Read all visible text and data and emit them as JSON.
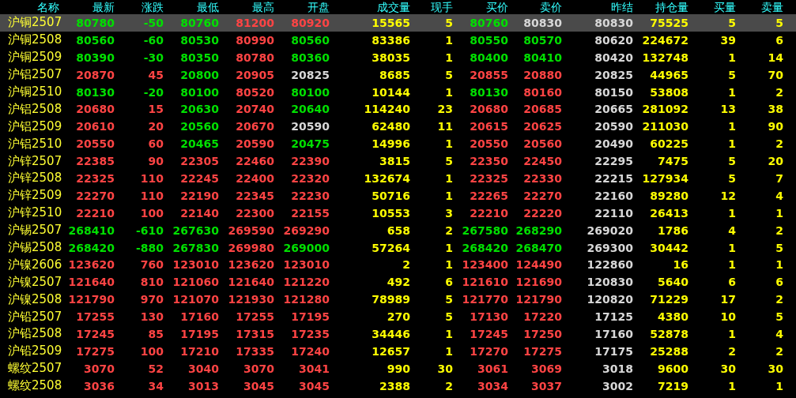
{
  "columns": [
    {
      "label": "名称",
      "kind": "name"
    },
    {
      "label": "最新",
      "kind": "price"
    },
    {
      "label": "涨跌",
      "kind": "price"
    },
    {
      "label": "最低",
      "kind": "price"
    },
    {
      "label": "最高",
      "kind": "price"
    },
    {
      "label": "开盘",
      "kind": "price"
    },
    {
      "label": "成交量",
      "kind": "volume"
    },
    {
      "label": "现手",
      "kind": "volume"
    },
    {
      "label": "买价",
      "kind": "price"
    },
    {
      "label": "卖价",
      "kind": "price"
    },
    {
      "label": "昨结",
      "kind": "plain"
    },
    {
      "label": "持仓量",
      "kind": "volume"
    },
    {
      "label": "买量",
      "kind": "volume"
    },
    {
      "label": "卖量",
      "kind": "volume"
    }
  ],
  "rows": [
    {
      "selected": true,
      "cells": [
        {
          "text": "沪铜2507"
        },
        {
          "text": "80780",
          "color": "#00e000"
        },
        {
          "text": "-50",
          "color": "#00e000"
        },
        {
          "text": "80760",
          "color": "#00e000"
        },
        {
          "text": "81200",
          "color": "#ff4444"
        },
        {
          "text": "80920",
          "color": "#ff4444"
        },
        {
          "text": "15565"
        },
        {
          "text": "5"
        },
        {
          "text": "80760",
          "color": "#00e000"
        },
        {
          "text": "80830",
          "color": "#d8d8d8"
        },
        {
          "text": "80830"
        },
        {
          "text": "75525"
        },
        {
          "text": "5"
        },
        {
          "text": "5"
        }
      ]
    },
    {
      "selected": false,
      "cells": [
        {
          "text": "沪铜2508"
        },
        {
          "text": "80560",
          "color": "#00e000"
        },
        {
          "text": "-60",
          "color": "#00e000"
        },
        {
          "text": "80530",
          "color": "#00e000"
        },
        {
          "text": "80990",
          "color": "#ff4444"
        },
        {
          "text": "80560",
          "color": "#00e000"
        },
        {
          "text": "83386"
        },
        {
          "text": "1"
        },
        {
          "text": "80550",
          "color": "#00e000"
        },
        {
          "text": "80570",
          "color": "#00e000"
        },
        {
          "text": "80620"
        },
        {
          "text": "224672"
        },
        {
          "text": "39"
        },
        {
          "text": "6"
        }
      ]
    },
    {
      "selected": false,
      "cells": [
        {
          "text": "沪铜2509"
        },
        {
          "text": "80390",
          "color": "#00e000"
        },
        {
          "text": "-30",
          "color": "#00e000"
        },
        {
          "text": "80350",
          "color": "#00e000"
        },
        {
          "text": "80780",
          "color": "#ff4444"
        },
        {
          "text": "80360",
          "color": "#00e000"
        },
        {
          "text": "38035"
        },
        {
          "text": "1"
        },
        {
          "text": "80400",
          "color": "#00e000"
        },
        {
          "text": "80410",
          "color": "#00e000"
        },
        {
          "text": "80420"
        },
        {
          "text": "132748"
        },
        {
          "text": "1"
        },
        {
          "text": "14"
        }
      ]
    },
    {
      "selected": false,
      "cells": [
        {
          "text": "沪铝2507"
        },
        {
          "text": "20870",
          "color": "#ff4444"
        },
        {
          "text": "45",
          "color": "#ff4444"
        },
        {
          "text": "20800",
          "color": "#00e000"
        },
        {
          "text": "20905",
          "color": "#ff4444"
        },
        {
          "text": "20825",
          "color": "#d8d8d8"
        },
        {
          "text": "8685"
        },
        {
          "text": "5"
        },
        {
          "text": "20855",
          "color": "#ff4444"
        },
        {
          "text": "20880",
          "color": "#ff4444"
        },
        {
          "text": "20825"
        },
        {
          "text": "44965"
        },
        {
          "text": "5"
        },
        {
          "text": "70"
        }
      ]
    },
    {
      "selected": false,
      "cells": [
        {
          "text": "沪铜2510"
        },
        {
          "text": "80130",
          "color": "#00e000"
        },
        {
          "text": "-20",
          "color": "#00e000"
        },
        {
          "text": "80100",
          "color": "#00e000"
        },
        {
          "text": "80520",
          "color": "#ff4444"
        },
        {
          "text": "80100",
          "color": "#00e000"
        },
        {
          "text": "10144"
        },
        {
          "text": "1"
        },
        {
          "text": "80130",
          "color": "#00e000"
        },
        {
          "text": "80160",
          "color": "#ff4444"
        },
        {
          "text": "80150"
        },
        {
          "text": "53808"
        },
        {
          "text": "1"
        },
        {
          "text": "2"
        }
      ]
    },
    {
      "selected": false,
      "cells": [
        {
          "text": "沪铝2508"
        },
        {
          "text": "20680",
          "color": "#ff4444"
        },
        {
          "text": "15",
          "color": "#ff4444"
        },
        {
          "text": "20630",
          "color": "#00e000"
        },
        {
          "text": "20740",
          "color": "#ff4444"
        },
        {
          "text": "20640",
          "color": "#00e000"
        },
        {
          "text": "114240"
        },
        {
          "text": "23"
        },
        {
          "text": "20680",
          "color": "#ff4444"
        },
        {
          "text": "20685",
          "color": "#ff4444"
        },
        {
          "text": "20665"
        },
        {
          "text": "281092"
        },
        {
          "text": "13"
        },
        {
          "text": "38"
        }
      ]
    },
    {
      "selected": false,
      "cells": [
        {
          "text": "沪铝2509"
        },
        {
          "text": "20610",
          "color": "#ff4444"
        },
        {
          "text": "20",
          "color": "#ff4444"
        },
        {
          "text": "20560",
          "color": "#00e000"
        },
        {
          "text": "20670",
          "color": "#ff4444"
        },
        {
          "text": "20590",
          "color": "#d8d8d8"
        },
        {
          "text": "62480"
        },
        {
          "text": "11"
        },
        {
          "text": "20615",
          "color": "#ff4444"
        },
        {
          "text": "20625",
          "color": "#ff4444"
        },
        {
          "text": "20590"
        },
        {
          "text": "211030"
        },
        {
          "text": "1"
        },
        {
          "text": "90"
        }
      ]
    },
    {
      "selected": false,
      "cells": [
        {
          "text": "沪铝2510"
        },
        {
          "text": "20550",
          "color": "#ff4444"
        },
        {
          "text": "60",
          "color": "#ff4444"
        },
        {
          "text": "20465",
          "color": "#00e000"
        },
        {
          "text": "20590",
          "color": "#ff4444"
        },
        {
          "text": "20475",
          "color": "#00e000"
        },
        {
          "text": "14996"
        },
        {
          "text": "1"
        },
        {
          "text": "20550",
          "color": "#ff4444"
        },
        {
          "text": "20560",
          "color": "#ff4444"
        },
        {
          "text": "20490"
        },
        {
          "text": "60225"
        },
        {
          "text": "1"
        },
        {
          "text": "2"
        }
      ]
    },
    {
      "selected": false,
      "cells": [
        {
          "text": "沪锌2507"
        },
        {
          "text": "22385",
          "color": "#ff4444"
        },
        {
          "text": "90",
          "color": "#ff4444"
        },
        {
          "text": "22305",
          "color": "#ff4444"
        },
        {
          "text": "22460",
          "color": "#ff4444"
        },
        {
          "text": "22390",
          "color": "#ff4444"
        },
        {
          "text": "3815"
        },
        {
          "text": "5"
        },
        {
          "text": "22350",
          "color": "#ff4444"
        },
        {
          "text": "22450",
          "color": "#ff4444"
        },
        {
          "text": "22295"
        },
        {
          "text": "7475"
        },
        {
          "text": "5"
        },
        {
          "text": "20"
        }
      ]
    },
    {
      "selected": false,
      "cells": [
        {
          "text": "沪锌2508"
        },
        {
          "text": "22325",
          "color": "#ff4444"
        },
        {
          "text": "110",
          "color": "#ff4444"
        },
        {
          "text": "22245",
          "color": "#ff4444"
        },
        {
          "text": "22400",
          "color": "#ff4444"
        },
        {
          "text": "22320",
          "color": "#ff4444"
        },
        {
          "text": "132674"
        },
        {
          "text": "1"
        },
        {
          "text": "22325",
          "color": "#ff4444"
        },
        {
          "text": "22330",
          "color": "#ff4444"
        },
        {
          "text": "22215"
        },
        {
          "text": "127934"
        },
        {
          "text": "5"
        },
        {
          "text": "7"
        }
      ]
    },
    {
      "selected": false,
      "cells": [
        {
          "text": "沪锌2509"
        },
        {
          "text": "22270",
          "color": "#ff4444"
        },
        {
          "text": "110",
          "color": "#ff4444"
        },
        {
          "text": "22190",
          "color": "#ff4444"
        },
        {
          "text": "22345",
          "color": "#ff4444"
        },
        {
          "text": "22230",
          "color": "#ff4444"
        },
        {
          "text": "50716"
        },
        {
          "text": "1"
        },
        {
          "text": "22265",
          "color": "#ff4444"
        },
        {
          "text": "22270",
          "color": "#ff4444"
        },
        {
          "text": "22160"
        },
        {
          "text": "89280"
        },
        {
          "text": "12"
        },
        {
          "text": "4"
        }
      ]
    },
    {
      "selected": false,
      "cells": [
        {
          "text": "沪锌2510"
        },
        {
          "text": "22210",
          "color": "#ff4444"
        },
        {
          "text": "100",
          "color": "#ff4444"
        },
        {
          "text": "22140",
          "color": "#ff4444"
        },
        {
          "text": "22300",
          "color": "#ff4444"
        },
        {
          "text": "22155",
          "color": "#ff4444"
        },
        {
          "text": "10553"
        },
        {
          "text": "3"
        },
        {
          "text": "22210",
          "color": "#ff4444"
        },
        {
          "text": "22220",
          "color": "#ff4444"
        },
        {
          "text": "22110"
        },
        {
          "text": "26413"
        },
        {
          "text": "1"
        },
        {
          "text": "1"
        }
      ]
    },
    {
      "selected": false,
      "cells": [
        {
          "text": "沪锡2507"
        },
        {
          "text": "268410",
          "color": "#00e000"
        },
        {
          "text": "-610",
          "color": "#00e000"
        },
        {
          "text": "267630",
          "color": "#00e000"
        },
        {
          "text": "269590",
          "color": "#ff4444"
        },
        {
          "text": "269290",
          "color": "#ff4444"
        },
        {
          "text": "658"
        },
        {
          "text": "2"
        },
        {
          "text": "267580",
          "color": "#00e000"
        },
        {
          "text": "268290",
          "color": "#00e000"
        },
        {
          "text": "269020"
        },
        {
          "text": "1786"
        },
        {
          "text": "4"
        },
        {
          "text": "2"
        }
      ]
    },
    {
      "selected": false,
      "cells": [
        {
          "text": "沪锡2508"
        },
        {
          "text": "268420",
          "color": "#00e000"
        },
        {
          "text": "-880",
          "color": "#00e000"
        },
        {
          "text": "267830",
          "color": "#00e000"
        },
        {
          "text": "269980",
          "color": "#ff4444"
        },
        {
          "text": "269000",
          "color": "#00e000"
        },
        {
          "text": "57264"
        },
        {
          "text": "1"
        },
        {
          "text": "268420",
          "color": "#00e000"
        },
        {
          "text": "268470",
          "color": "#00e000"
        },
        {
          "text": "269300"
        },
        {
          "text": "30442"
        },
        {
          "text": "1"
        },
        {
          "text": "5"
        }
      ]
    },
    {
      "selected": false,
      "cells": [
        {
          "text": "沪镍2606"
        },
        {
          "text": "123620",
          "color": "#ff4444"
        },
        {
          "text": "760",
          "color": "#ff4444"
        },
        {
          "text": "123010",
          "color": "#ff4444"
        },
        {
          "text": "123620",
          "color": "#ff4444"
        },
        {
          "text": "123010",
          "color": "#ff4444"
        },
        {
          "text": "2"
        },
        {
          "text": "1"
        },
        {
          "text": "123400",
          "color": "#ff4444"
        },
        {
          "text": "124490",
          "color": "#ff4444"
        },
        {
          "text": "122860"
        },
        {
          "text": "16"
        },
        {
          "text": "1"
        },
        {
          "text": "1"
        }
      ]
    },
    {
      "selected": false,
      "cells": [
        {
          "text": "沪镍2507"
        },
        {
          "text": "121640",
          "color": "#ff4444"
        },
        {
          "text": "810",
          "color": "#ff4444"
        },
        {
          "text": "121060",
          "color": "#ff4444"
        },
        {
          "text": "121640",
          "color": "#ff4444"
        },
        {
          "text": "121220",
          "color": "#ff4444"
        },
        {
          "text": "492"
        },
        {
          "text": "6"
        },
        {
          "text": "121610",
          "color": "#ff4444"
        },
        {
          "text": "121690",
          "color": "#ff4444"
        },
        {
          "text": "120830"
        },
        {
          "text": "5640"
        },
        {
          "text": "6"
        },
        {
          "text": "6"
        }
      ]
    },
    {
      "selected": false,
      "cells": [
        {
          "text": "沪镍2508"
        },
        {
          "text": "121790",
          "color": "#ff4444"
        },
        {
          "text": "970",
          "color": "#ff4444"
        },
        {
          "text": "121070",
          "color": "#ff4444"
        },
        {
          "text": "121930",
          "color": "#ff4444"
        },
        {
          "text": "121280",
          "color": "#ff4444"
        },
        {
          "text": "78989"
        },
        {
          "text": "5"
        },
        {
          "text": "121770",
          "color": "#ff4444"
        },
        {
          "text": "121790",
          "color": "#ff4444"
        },
        {
          "text": "120820"
        },
        {
          "text": "71229"
        },
        {
          "text": "17"
        },
        {
          "text": "2"
        }
      ]
    },
    {
      "selected": false,
      "cells": [
        {
          "text": "沪铅2507"
        },
        {
          "text": "17255",
          "color": "#ff4444"
        },
        {
          "text": "130",
          "color": "#ff4444"
        },
        {
          "text": "17160",
          "color": "#ff4444"
        },
        {
          "text": "17255",
          "color": "#ff4444"
        },
        {
          "text": "17195",
          "color": "#ff4444"
        },
        {
          "text": "270"
        },
        {
          "text": "5"
        },
        {
          "text": "17130",
          "color": "#ff4444"
        },
        {
          "text": "17220",
          "color": "#ff4444"
        },
        {
          "text": "17125"
        },
        {
          "text": "4380"
        },
        {
          "text": "10"
        },
        {
          "text": "5"
        }
      ]
    },
    {
      "selected": false,
      "cells": [
        {
          "text": "沪铅2508"
        },
        {
          "text": "17245",
          "color": "#ff4444"
        },
        {
          "text": "85",
          "color": "#ff4444"
        },
        {
          "text": "17195",
          "color": "#ff4444"
        },
        {
          "text": "17315",
          "color": "#ff4444"
        },
        {
          "text": "17235",
          "color": "#ff4444"
        },
        {
          "text": "34446"
        },
        {
          "text": "1"
        },
        {
          "text": "17245",
          "color": "#ff4444"
        },
        {
          "text": "17250",
          "color": "#ff4444"
        },
        {
          "text": "17160"
        },
        {
          "text": "52878"
        },
        {
          "text": "1"
        },
        {
          "text": "4"
        }
      ]
    },
    {
      "selected": false,
      "cells": [
        {
          "text": "沪铅2509"
        },
        {
          "text": "17275",
          "color": "#ff4444"
        },
        {
          "text": "100",
          "color": "#ff4444"
        },
        {
          "text": "17210",
          "color": "#ff4444"
        },
        {
          "text": "17335",
          "color": "#ff4444"
        },
        {
          "text": "17240",
          "color": "#ff4444"
        },
        {
          "text": "12657"
        },
        {
          "text": "1"
        },
        {
          "text": "17270",
          "color": "#ff4444"
        },
        {
          "text": "17275",
          "color": "#ff4444"
        },
        {
          "text": "17175"
        },
        {
          "text": "25288"
        },
        {
          "text": "2"
        },
        {
          "text": "2"
        }
      ]
    },
    {
      "selected": false,
      "cells": [
        {
          "text": "螺纹2507"
        },
        {
          "text": "3070",
          "color": "#ff4444"
        },
        {
          "text": "52",
          "color": "#ff4444"
        },
        {
          "text": "3040",
          "color": "#ff4444"
        },
        {
          "text": "3070",
          "color": "#ff4444"
        },
        {
          "text": "3041",
          "color": "#ff4444"
        },
        {
          "text": "990"
        },
        {
          "text": "30"
        },
        {
          "text": "3061",
          "color": "#ff4444"
        },
        {
          "text": "3069",
          "color": "#ff4444"
        },
        {
          "text": "3018"
        },
        {
          "text": "9600"
        },
        {
          "text": "30"
        },
        {
          "text": "30"
        }
      ]
    },
    {
      "selected": false,
      "cells": [
        {
          "text": "螺纹2508"
        },
        {
          "text": "3036",
          "color": "#ff4444"
        },
        {
          "text": "34",
          "color": "#ff4444"
        },
        {
          "text": "3013",
          "color": "#ff4444"
        },
        {
          "text": "3045",
          "color": "#ff4444"
        },
        {
          "text": "3045",
          "color": "#ff4444"
        },
        {
          "text": "2388"
        },
        {
          "text": "2"
        },
        {
          "text": "3034",
          "color": "#ff4444"
        },
        {
          "text": "3037",
          "color": "#ff4444"
        },
        {
          "text": "3002"
        },
        {
          "text": "7219"
        },
        {
          "text": "1"
        },
        {
          "text": "1"
        }
      ]
    }
  ]
}
